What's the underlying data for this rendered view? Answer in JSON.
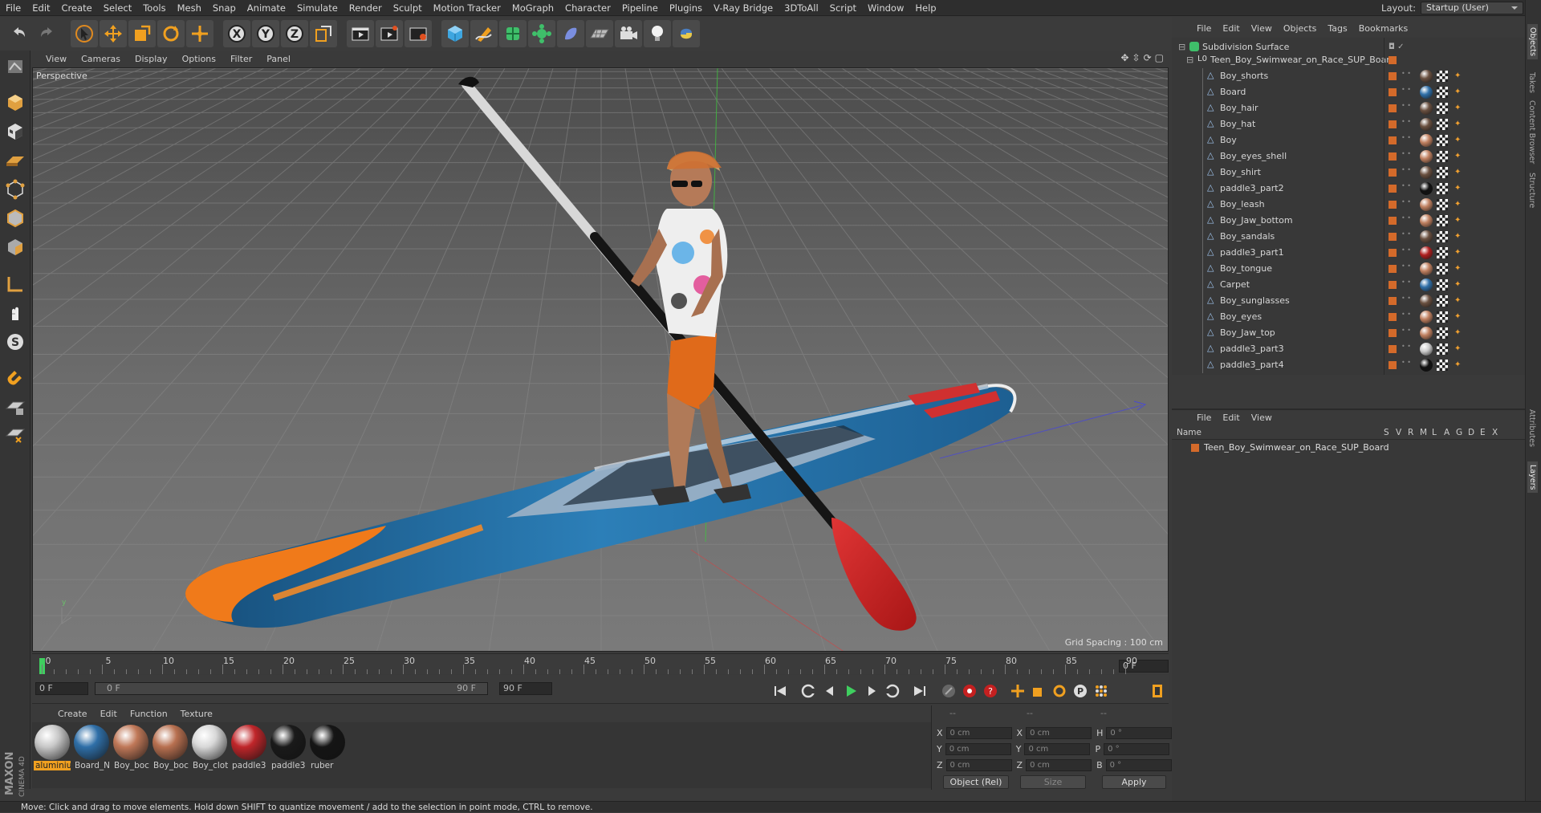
{
  "menubar": [
    "File",
    "Edit",
    "Create",
    "Select",
    "Tools",
    "Mesh",
    "Snap",
    "Animate",
    "Simulate",
    "Render",
    "Sculpt",
    "Motion Tracker",
    "MoGraph",
    "Character",
    "Pipeline",
    "Plugins",
    "V-Ray Bridge",
    "3DToAll",
    "Script",
    "Window",
    "Help"
  ],
  "layout": {
    "label": "Layout:",
    "value": "Startup (User)"
  },
  "viewport": {
    "menu": [
      "View",
      "Cameras",
      "Display",
      "Options",
      "Filter",
      "Panel"
    ],
    "label": "Perspective",
    "grid_spacing": "Grid Spacing : 100 cm"
  },
  "timeline": {
    "ticks": [
      "0",
      "5",
      "10",
      "15",
      "20",
      "25",
      "30",
      "35",
      "40",
      "45",
      "50",
      "55",
      "60",
      "65",
      "70",
      "75",
      "80",
      "85",
      "90"
    ],
    "current_frame_field": "0 F",
    "start_field": "0 F",
    "range_start": "0 F",
    "range_end": "90 F",
    "end_field": "90 F",
    "max_field": "90 F",
    "right_field": "0 F"
  },
  "materials": {
    "menu": [
      "Create",
      "Edit",
      "Function",
      "Texture"
    ],
    "items": [
      {
        "name": "aluminium",
        "color": "#c8c8c8",
        "selected": true
      },
      {
        "name": "Board_N",
        "color": "#2f6fa8",
        "selected": false
      },
      {
        "name": "Boy_boc",
        "color": "#c07858",
        "selected": false
      },
      {
        "name": "Boy_boc",
        "color": "#b87050",
        "selected": false
      },
      {
        "name": "Boy_clot",
        "color": "#d8d8d8",
        "selected": false
      },
      {
        "name": "paddle3",
        "color": "#c0262a",
        "selected": false
      },
      {
        "name": "paddle3",
        "color": "#1a1a1a",
        "selected": false
      },
      {
        "name": "ruber",
        "color": "#151515",
        "selected": false
      }
    ]
  },
  "coords": {
    "header": [
      "--",
      "--",
      "--"
    ],
    "rows": [
      {
        "a": "X",
        "av": "0 cm",
        "b": "X",
        "bv": "0 cm",
        "c": "H",
        "cv": "0 °"
      },
      {
        "a": "Y",
        "av": "0 cm",
        "b": "Y",
        "bv": "0 cm",
        "c": "P",
        "cv": "0 °"
      },
      {
        "a": "Z",
        "av": "0 cm",
        "b": "Z",
        "bv": "0 cm",
        "c": "B",
        "cv": "0 °"
      }
    ],
    "mode": "Object (Rel)",
    "size": "Size",
    "apply": "Apply"
  },
  "objects": {
    "menu": [
      "File",
      "Edit",
      "View",
      "Objects",
      "Tags",
      "Bookmarks"
    ],
    "root": "Subdivision Surface",
    "group": "Teen_Boy_Swimwear_on_Race_SUP_Board",
    "children": [
      {
        "name": "Boy_shorts",
        "tag": "#6a5040"
      },
      {
        "name": "Board",
        "tag": "#2f6fa8"
      },
      {
        "name": "Boy_hair",
        "tag": "#6a5040"
      },
      {
        "name": "Boy_hat",
        "tag": "#6a5040"
      },
      {
        "name": "Boy",
        "tag": "#c08060"
      },
      {
        "name": "Boy_eyes_shell",
        "tag": "#c08060"
      },
      {
        "name": "Boy_shirt",
        "tag": "#6a5040"
      },
      {
        "name": "paddle3_part2",
        "tag": "#111111"
      },
      {
        "name": "Boy_leash",
        "tag": "#c08060"
      },
      {
        "name": "Boy_Jaw_bottom",
        "tag": "#c08060"
      },
      {
        "name": "Boy_sandals",
        "tag": "#6a5040"
      },
      {
        "name": "paddle3_part1",
        "tag": "#b02020"
      },
      {
        "name": "Boy_tongue",
        "tag": "#c08060"
      },
      {
        "name": "Carpet",
        "tag": "#2f6fa8"
      },
      {
        "name": "Boy_sunglasses",
        "tag": "#6a5040"
      },
      {
        "name": "Boy_eyes",
        "tag": "#c08060"
      },
      {
        "name": "Boy_Jaw_top",
        "tag": "#c08060"
      },
      {
        "name": "paddle3_part3",
        "tag": "#cccccc"
      },
      {
        "name": "paddle3_part4",
        "tag": "#111111"
      }
    ]
  },
  "layers": {
    "menu": [
      "File",
      "Edit",
      "View"
    ],
    "headers": [
      "Name",
      "S",
      "V",
      "R",
      "M",
      "L",
      "A",
      "G",
      "D",
      "E",
      "X"
    ],
    "row": "Teen_Boy_Swimwear_on_Race_SUP_Board"
  },
  "sidetabs": [
    "Objects",
    "Takes",
    "Content Browser",
    "Structure",
    "Attributes",
    "Layers"
  ],
  "status": "Move: Click and drag to move elements. Hold down SHIFT to quantize movement / add to the selection in point mode, CTRL to remove.",
  "logo": {
    "line1": "MAXON",
    "line2": "CINEMA 4D"
  }
}
